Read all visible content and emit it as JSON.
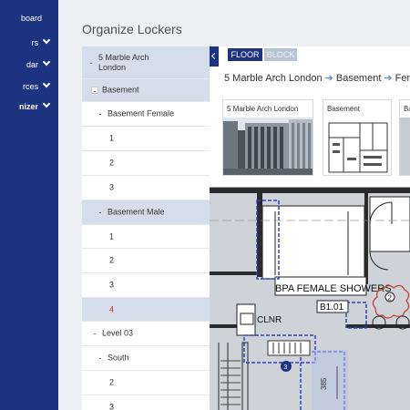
{
  "sidebar": {
    "items": [
      {
        "label": "board",
        "chevron": false,
        "active": false
      },
      {
        "label": "rs",
        "chevron": true,
        "active": false
      },
      {
        "label": "dar",
        "chevron": true,
        "active": false
      },
      {
        "label": "rces",
        "chevron": true,
        "active": false
      },
      {
        "label": "nizer",
        "chevron": true,
        "active": true
      }
    ]
  },
  "page": {
    "title": "Organize Lockers"
  },
  "tree": {
    "rows": [
      {
        "label": "5 Marble Arch London",
        "toggle": "-",
        "level": 0,
        "highlight": true,
        "plus": true
      },
      {
        "label": "Basement",
        "toggle": "-",
        "level": 1,
        "highlight": true,
        "plus": true
      },
      {
        "label": "Basement Female",
        "toggle": "-",
        "level": 2,
        "highlight": false,
        "plus": true
      },
      {
        "label": "1",
        "toggle": "",
        "level": 3,
        "highlight": false,
        "plus": false
      },
      {
        "label": "2",
        "toggle": "",
        "level": 3,
        "highlight": false,
        "plus": false
      },
      {
        "label": "3",
        "toggle": "",
        "level": 3,
        "highlight": false,
        "plus": false
      },
      {
        "label": "Basement Male",
        "toggle": "-",
        "level": 2,
        "highlight": true,
        "plus": true
      },
      {
        "label": "1",
        "toggle": "",
        "level": 3,
        "highlight": false,
        "plus": false
      },
      {
        "label": "2",
        "toggle": "",
        "level": 3,
        "highlight": false,
        "plus": false
      },
      {
        "label": "3",
        "toggle": "",
        "level": 3,
        "highlight": false,
        "plus": false
      },
      {
        "label": "4",
        "toggle": "",
        "level": 3,
        "highlight": true,
        "plus": false,
        "color": "#c0392b"
      },
      {
        "label": "Level 03",
        "toggle": "-",
        "level": 1,
        "highlight": false,
        "plus": true
      },
      {
        "label": "South",
        "toggle": "-",
        "level": 2,
        "highlight": false,
        "plus": true
      },
      {
        "label": "2",
        "toggle": "",
        "level": 3,
        "highlight": false,
        "plus": false
      },
      {
        "label": "3",
        "toggle": "",
        "level": 3,
        "highlight": false,
        "plus": false
      }
    ]
  },
  "viewer": {
    "tabs": {
      "floor": "FLOOR",
      "block": "BLOCK"
    },
    "breadcrumb": [
      "5 Marble Arch London",
      "Basement",
      "Female"
    ],
    "thumbnails": [
      {
        "label": "5 Marble Arch London"
      },
      {
        "label": "Basement"
      },
      {
        "label": "Ba"
      }
    ],
    "plan": {
      "room_label": "BPA FEMALE SHOWERS",
      "room_code": "B1.01",
      "cleaner_label": "CLNR",
      "marker_number": "3",
      "door_number": "2",
      "dimension": "385"
    }
  },
  "colors": {
    "sidebar": "#1c3380",
    "accent": "#3c86c8",
    "highlight_row": "#d5ddea",
    "markup": "#2b3fc7",
    "cloud": "#c0392b"
  }
}
